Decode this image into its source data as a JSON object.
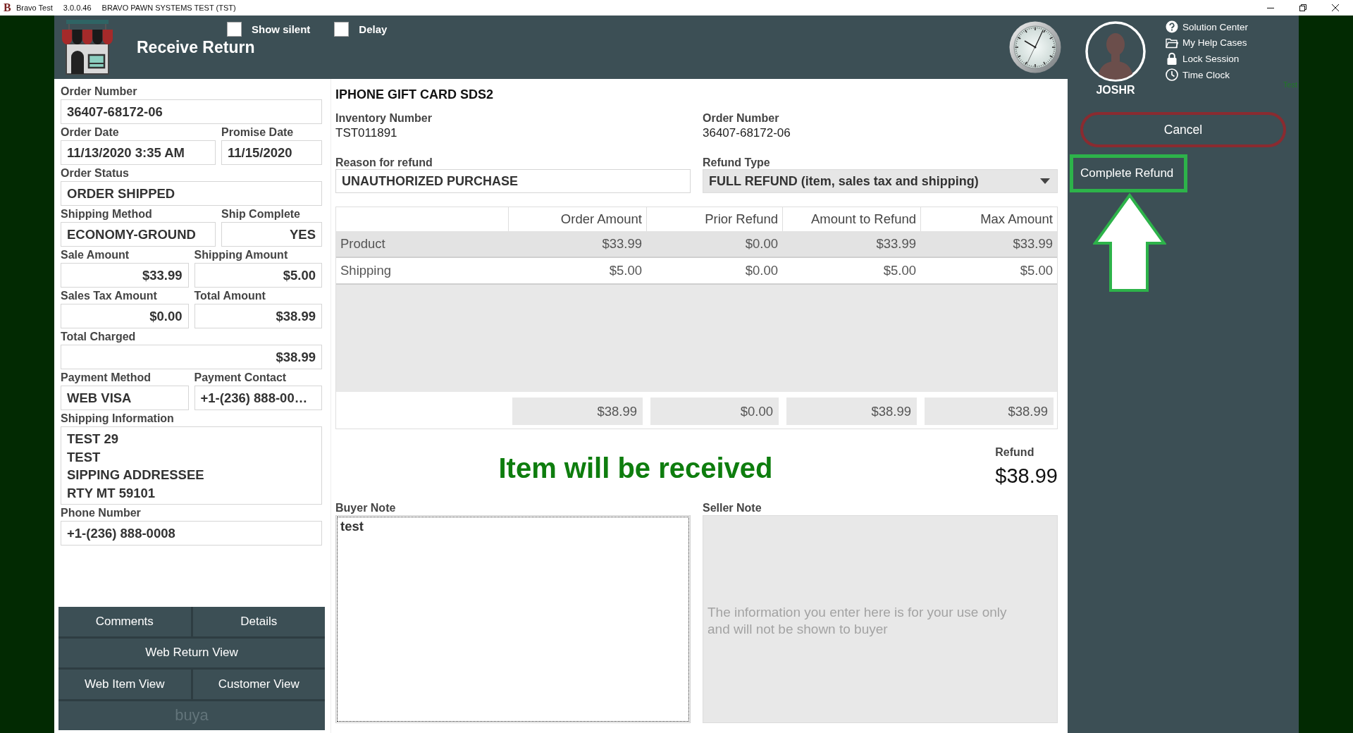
{
  "title_bar": {
    "logo": "B",
    "app_name": "Bravo Test",
    "version": "3.0.0.46",
    "system": "BRAVO PAWN SYSTEMS TEST (TST)"
  },
  "header": {
    "title": "Receive Return",
    "toggles": [
      {
        "label": "Show silent",
        "checked": false
      },
      {
        "label": "Delay",
        "checked": false
      }
    ]
  },
  "user": {
    "name": "JOSHR",
    "links": [
      {
        "label": "Solution Center"
      },
      {
        "label": "My Help Cases"
      },
      {
        "label": "Lock Session"
      },
      {
        "label": "Time Clock"
      }
    ],
    "env_tag": "Test"
  },
  "actions": {
    "cancel": "Cancel",
    "complete": "Complete Refund"
  },
  "order_panel": {
    "rows": [
      {
        "kind": "single",
        "fields": [
          {
            "label": "Order Number",
            "value": "36407-68172-06",
            "kind": "text"
          }
        ]
      },
      {
        "kind": "pair-wide",
        "fields": [
          {
            "label": "Order Date",
            "value": "11/13/2020 3:35 AM",
            "kind": "text"
          },
          {
            "label": "Promise Date",
            "value": "11/15/2020",
            "kind": "text"
          }
        ]
      },
      {
        "kind": "single",
        "fields": [
          {
            "label": "Order Status",
            "value": "ORDER SHIPPED",
            "kind": "text"
          }
        ]
      },
      {
        "kind": "pair-wide",
        "fields": [
          {
            "label": "Shipping Method",
            "value": "ECONOMY-GROUND",
            "kind": "text"
          },
          {
            "label": "Ship Complete",
            "value": "YES",
            "kind": "flag"
          }
        ]
      },
      {
        "kind": "pair",
        "fields": [
          {
            "label": "Sale Amount",
            "value": "$33.99",
            "kind": "amount"
          },
          {
            "label": "Shipping Amount",
            "value": "$5.00",
            "kind": "amount"
          }
        ]
      },
      {
        "kind": "pair",
        "fields": [
          {
            "label": "Sales Tax Amount",
            "value": "$0.00",
            "kind": "amount"
          },
          {
            "label": "Total Amount",
            "value": "$38.99",
            "kind": "amount"
          }
        ]
      },
      {
        "kind": "single",
        "fields": [
          {
            "label": "Total Charged",
            "value": "$38.99",
            "kind": "amount"
          }
        ]
      },
      {
        "kind": "pair",
        "fields": [
          {
            "label": "Payment Method",
            "value": "WEB VISA",
            "kind": "text"
          },
          {
            "label": "Payment Contact",
            "value": "+1-(236) 888-00…",
            "kind": "text"
          }
        ]
      },
      {
        "kind": "single",
        "fields": [
          {
            "label": "Shipping Information",
            "lines": [
              "TEST 29",
              "TEST",
              "SIPPING ADDRESSEE",
              "RTY MT 59101"
            ],
            "kind": "address"
          }
        ]
      },
      {
        "kind": "single",
        "fields": [
          {
            "label": "Phone Number",
            "value": "+1-(236) 888-0008",
            "kind": "text"
          }
        ]
      }
    ],
    "buttons": [
      [
        {
          "label": "Comments",
          "dimmed": false
        },
        {
          "label": "Details",
          "dimmed": false
        }
      ],
      [
        {
          "label": "Web Return View",
          "dimmed": false
        }
      ],
      [
        {
          "label": "Web Item View",
          "dimmed": false
        },
        {
          "label": "Customer View",
          "dimmed": false
        }
      ],
      [
        {
          "label": "buya",
          "dimmed": true
        }
      ]
    ]
  },
  "item": {
    "title": "IPHONE GIFT CARD SDS2",
    "info": [
      {
        "label": "Inventory Number",
        "value": "TST011891"
      },
      {
        "label": "Order Number",
        "value": "36407-68172-06"
      }
    ],
    "reason": {
      "label": "Reason for refund",
      "value": "UNAUTHORIZED PURCHASE"
    },
    "refund_type": {
      "label": "Refund Type",
      "value": "FULL REFUND (item, sales tax and shipping)"
    }
  },
  "table": {
    "columns": [
      "Order Amount",
      "Prior Refund",
      "Amount to Refund",
      "Max Amount"
    ],
    "rows": [
      {
        "label": "Product",
        "cells": [
          "$33.99",
          "$0.00",
          "$33.99",
          "$33.99"
        ],
        "selected": true
      },
      {
        "label": "Shipping",
        "cells": [
          "$5.00",
          "$0.00",
          "$5.00",
          "$5.00"
        ],
        "selected": false
      }
    ],
    "totals": [
      "$38.99",
      "$0.00",
      "$38.99",
      "$38.99"
    ]
  },
  "status": {
    "message": "Item will be received",
    "refund_label": "Refund",
    "refund_amount": "$38.99"
  },
  "notes": {
    "buyer": {
      "label": "Buyer Note",
      "value": "test"
    },
    "seller": {
      "label": "Seller Note",
      "placeholder": "The information you enter here is for your use only and will not be shown to buyer"
    }
  }
}
